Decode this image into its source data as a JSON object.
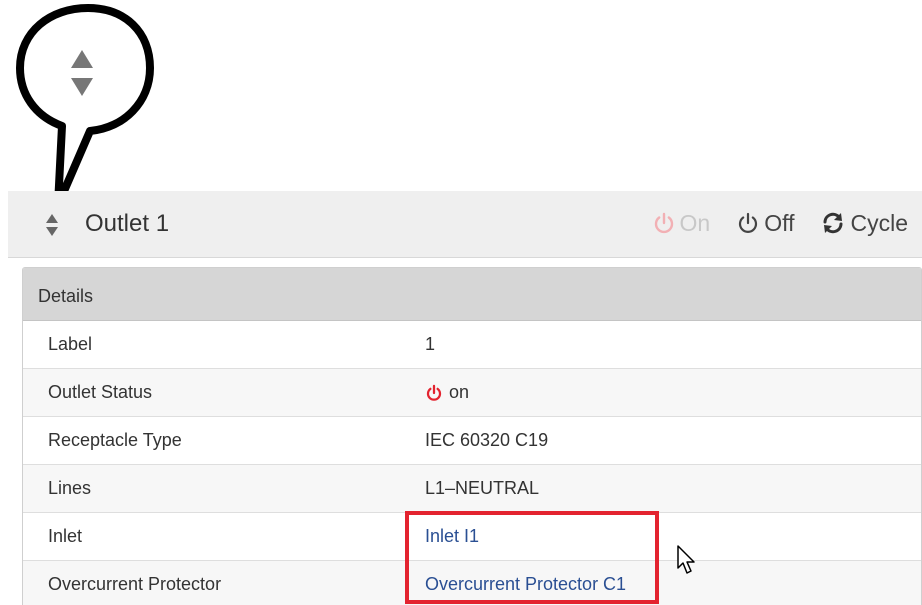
{
  "header": {
    "title": "Outlet 1",
    "actions": {
      "on_label": "On",
      "off_label": "Off",
      "cycle_label": "Cycle"
    }
  },
  "details": {
    "heading": "Details",
    "rows": [
      {
        "label": "Label",
        "value": "1"
      },
      {
        "label": "Outlet Status",
        "value": "on"
      },
      {
        "label": "Receptacle Type",
        "value": "IEC 60320 C19"
      },
      {
        "label": "Lines",
        "value": "L1–NEUTRAL"
      },
      {
        "label": "Inlet",
        "value": "Inlet I1"
      },
      {
        "label": "Overcurrent Protector",
        "value": "Overcurrent Protector C1"
      }
    ]
  },
  "colors": {
    "power_on": "#e3232f",
    "link": "#2a4f93",
    "highlight": "#e3232f"
  },
  "icons": [
    "sort-arrows-icon",
    "power-icon",
    "refresh-icon",
    "mouse-cursor-icon"
  ]
}
